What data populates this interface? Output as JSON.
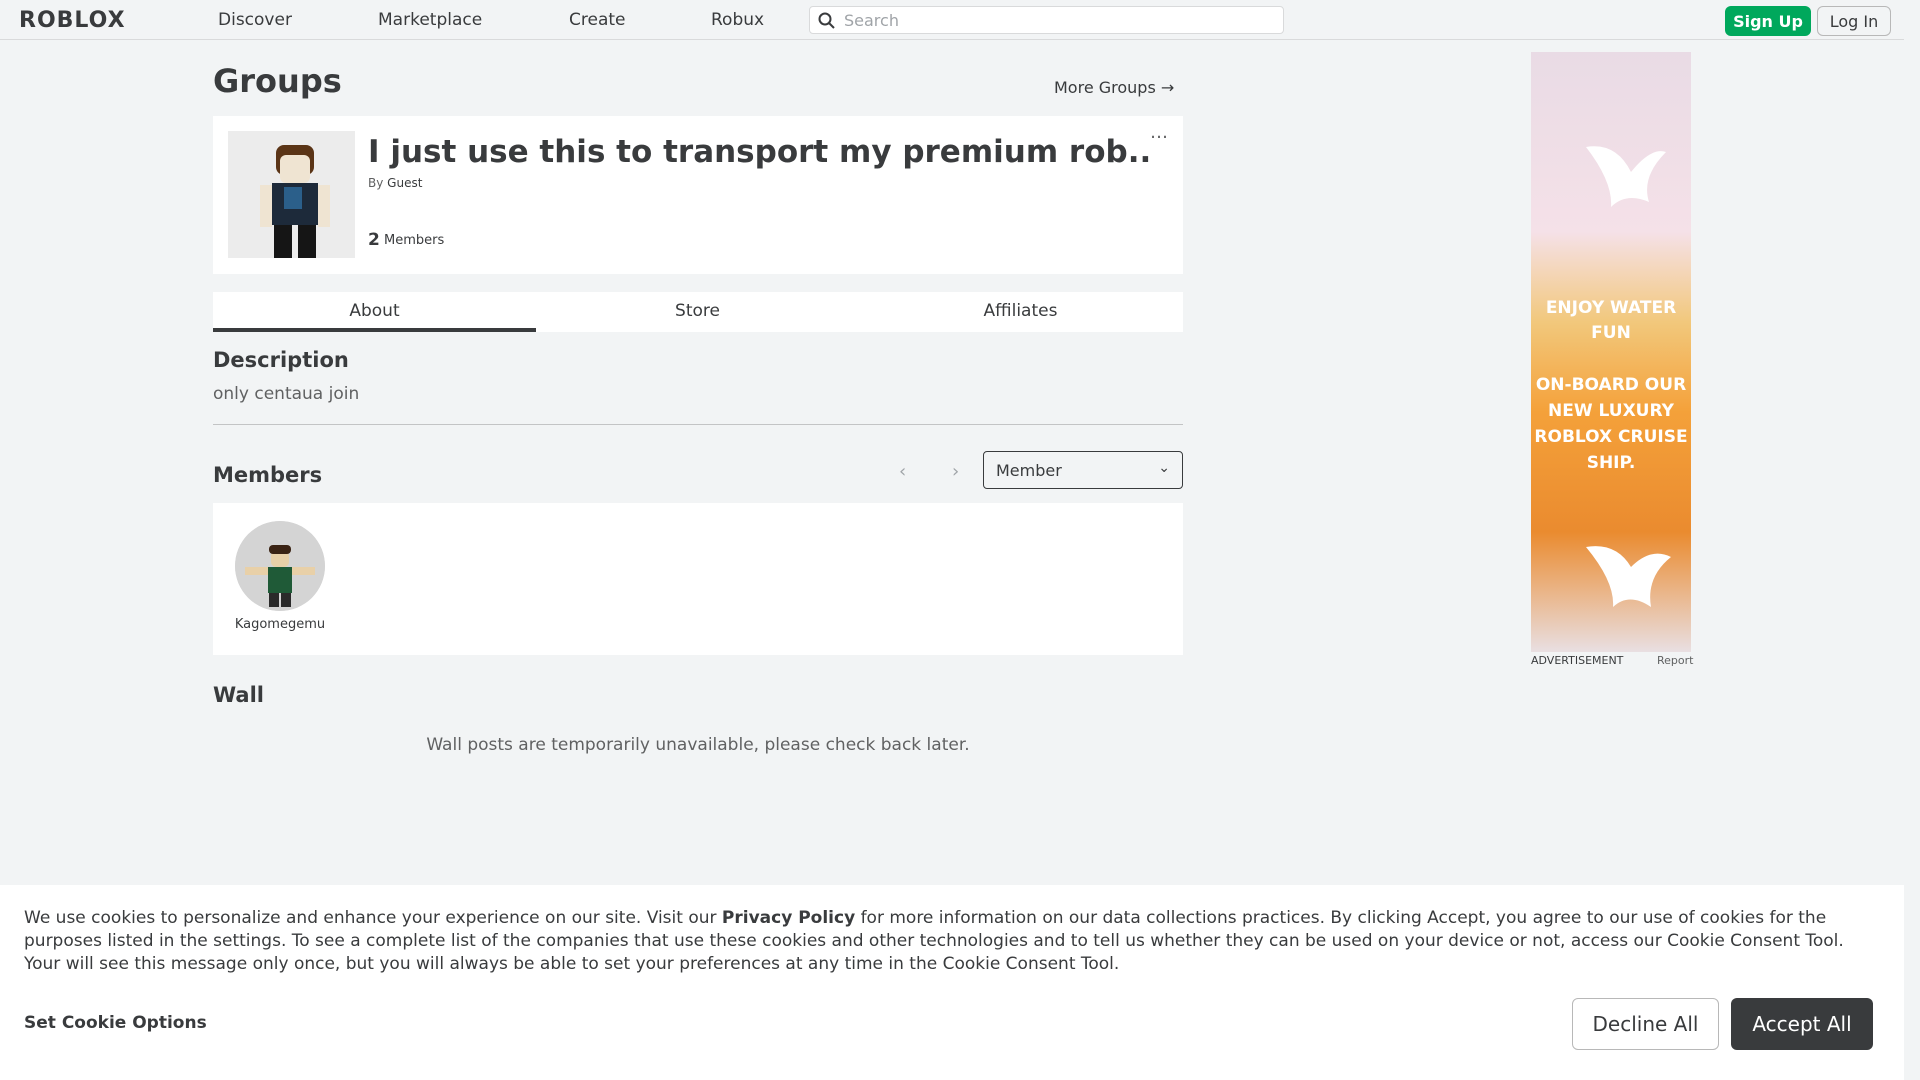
{
  "nav": {
    "logo": "ROBLOX",
    "links": [
      "Discover",
      "Marketplace",
      "Create",
      "Robux"
    ],
    "search_placeholder": "Search",
    "signup_label": "Sign Up",
    "login_label": "Log In"
  },
  "page": {
    "title": "Groups",
    "more_groups": "More Groups →"
  },
  "group": {
    "name": "I just use this to transport my premium rob...",
    "by_prefix": "By",
    "owner": "Guest",
    "member_count": "2",
    "member_label": "Members",
    "menu": "…"
  },
  "tabs": [
    "About",
    "Store",
    "Affiliates"
  ],
  "about": {
    "description_title": "Description",
    "description_text": "only centaua join",
    "members_title": "Members",
    "role_selected": "Member",
    "members": [
      {
        "name": "Kagomegemu"
      }
    ],
    "wall_title": "Wall",
    "wall_message": "Wall posts are temporarily unavailable, please check back later."
  },
  "ad": {
    "line1": "ENJOY WATER",
    "line2": "FUN",
    "line3": "ON-BOARD OUR",
    "line4": "NEW LUXURY",
    "line5": "ROBLOX CRUISE",
    "line6": "SHIP.",
    "label": "ADVERTISEMENT",
    "report": "Report"
  },
  "cookie": {
    "text_before": "We use cookies to personalize and enhance your experience on our site. Visit our ",
    "link": "Privacy Policy",
    "text_after": " for more information on our data collections practices. By clicking Accept, you agree to our use of cookies for the purposes listed in the settings. To see a complete list of the companies that use these cookies and other technologies and to tell us whether they can be used on your device or not, access our Cookie Consent Tool. Your will see this message only once, but you will always be able to set your preferences at any time in the Cookie Consent Tool.",
    "set_options": "Set Cookie Options",
    "decline": "Decline All",
    "accept": "Accept All"
  },
  "colors": {
    "signup_green": "#00a85c",
    "accept_dark": "#393b3d",
    "page_bg": "#f2f4f5"
  }
}
